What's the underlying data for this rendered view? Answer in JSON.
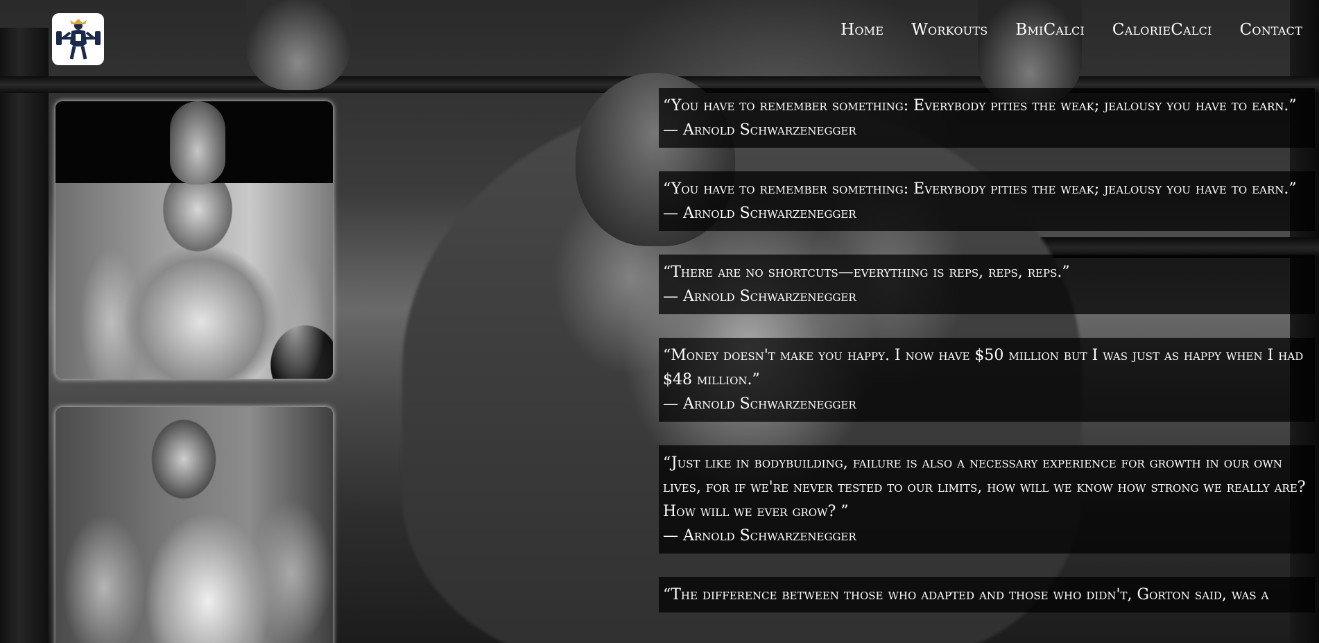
{
  "nav": {
    "items": [
      "Home",
      "Workouts",
      "BmiCalci",
      "CalorieCalci",
      "Contact"
    ]
  },
  "logo": {
    "icon": "bodybuilder-barbell-logo"
  },
  "photos": [
    {
      "icon": "bodybuilder-photo"
    },
    {
      "icon": "bodybuilder-photo"
    }
  ],
  "quotes": [
    {
      "text": "“You have to remember something: Everybody pities the weak; jealousy you have to earn.”",
      "author": "— Arnold Schwarzenegger"
    },
    {
      "text": "“You have to remember something: Everybody pities the weak; jealousy you have to earn.”",
      "author": "— Arnold Schwarzenegger"
    },
    {
      "text": "“There are no shortcuts—everything is reps, reps, reps.”",
      "author": "— Arnold Schwarzenegger"
    },
    {
      "text": "“Money doesn't make you happy. I now have $50 million but I was just as happy when I had $48 million.”",
      "author": "— Arnold Schwarzenegger"
    },
    {
      "text": "“Just like in bodybuilding, failure is also a necessary experience for growth in our own lives, for if we're never tested to our limits, how will we know how strong we really are? How will we ever grow? ”",
      "author": "— Arnold Schwarzenegger"
    },
    {
      "text": "“The difference between those who adapted and those who didn't, Gorton said, was a",
      "author": ""
    }
  ],
  "colors": {
    "text": "#ffffff",
    "quote_background": "rgba(0,0,0,0.72)"
  }
}
